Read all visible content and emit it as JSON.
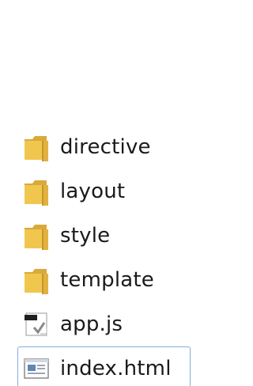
{
  "explorer": {
    "items": [
      {
        "label": "directive",
        "type": "folder",
        "icon": "folder-icon"
      },
      {
        "label": "layout",
        "type": "folder",
        "icon": "folder-icon"
      },
      {
        "label": "style",
        "type": "folder",
        "icon": "folder-icon"
      },
      {
        "label": "template",
        "type": "folder",
        "icon": "folder-icon"
      },
      {
        "label": "app.js",
        "type": "file",
        "icon": "js-file-icon"
      },
      {
        "label": "index.html",
        "type": "file",
        "icon": "html-file-icon",
        "selected": true
      }
    ]
  },
  "colors": {
    "folder_front": "#f0c64f",
    "folder_back": "#d9a93a",
    "selection_border": "#84acdd"
  }
}
